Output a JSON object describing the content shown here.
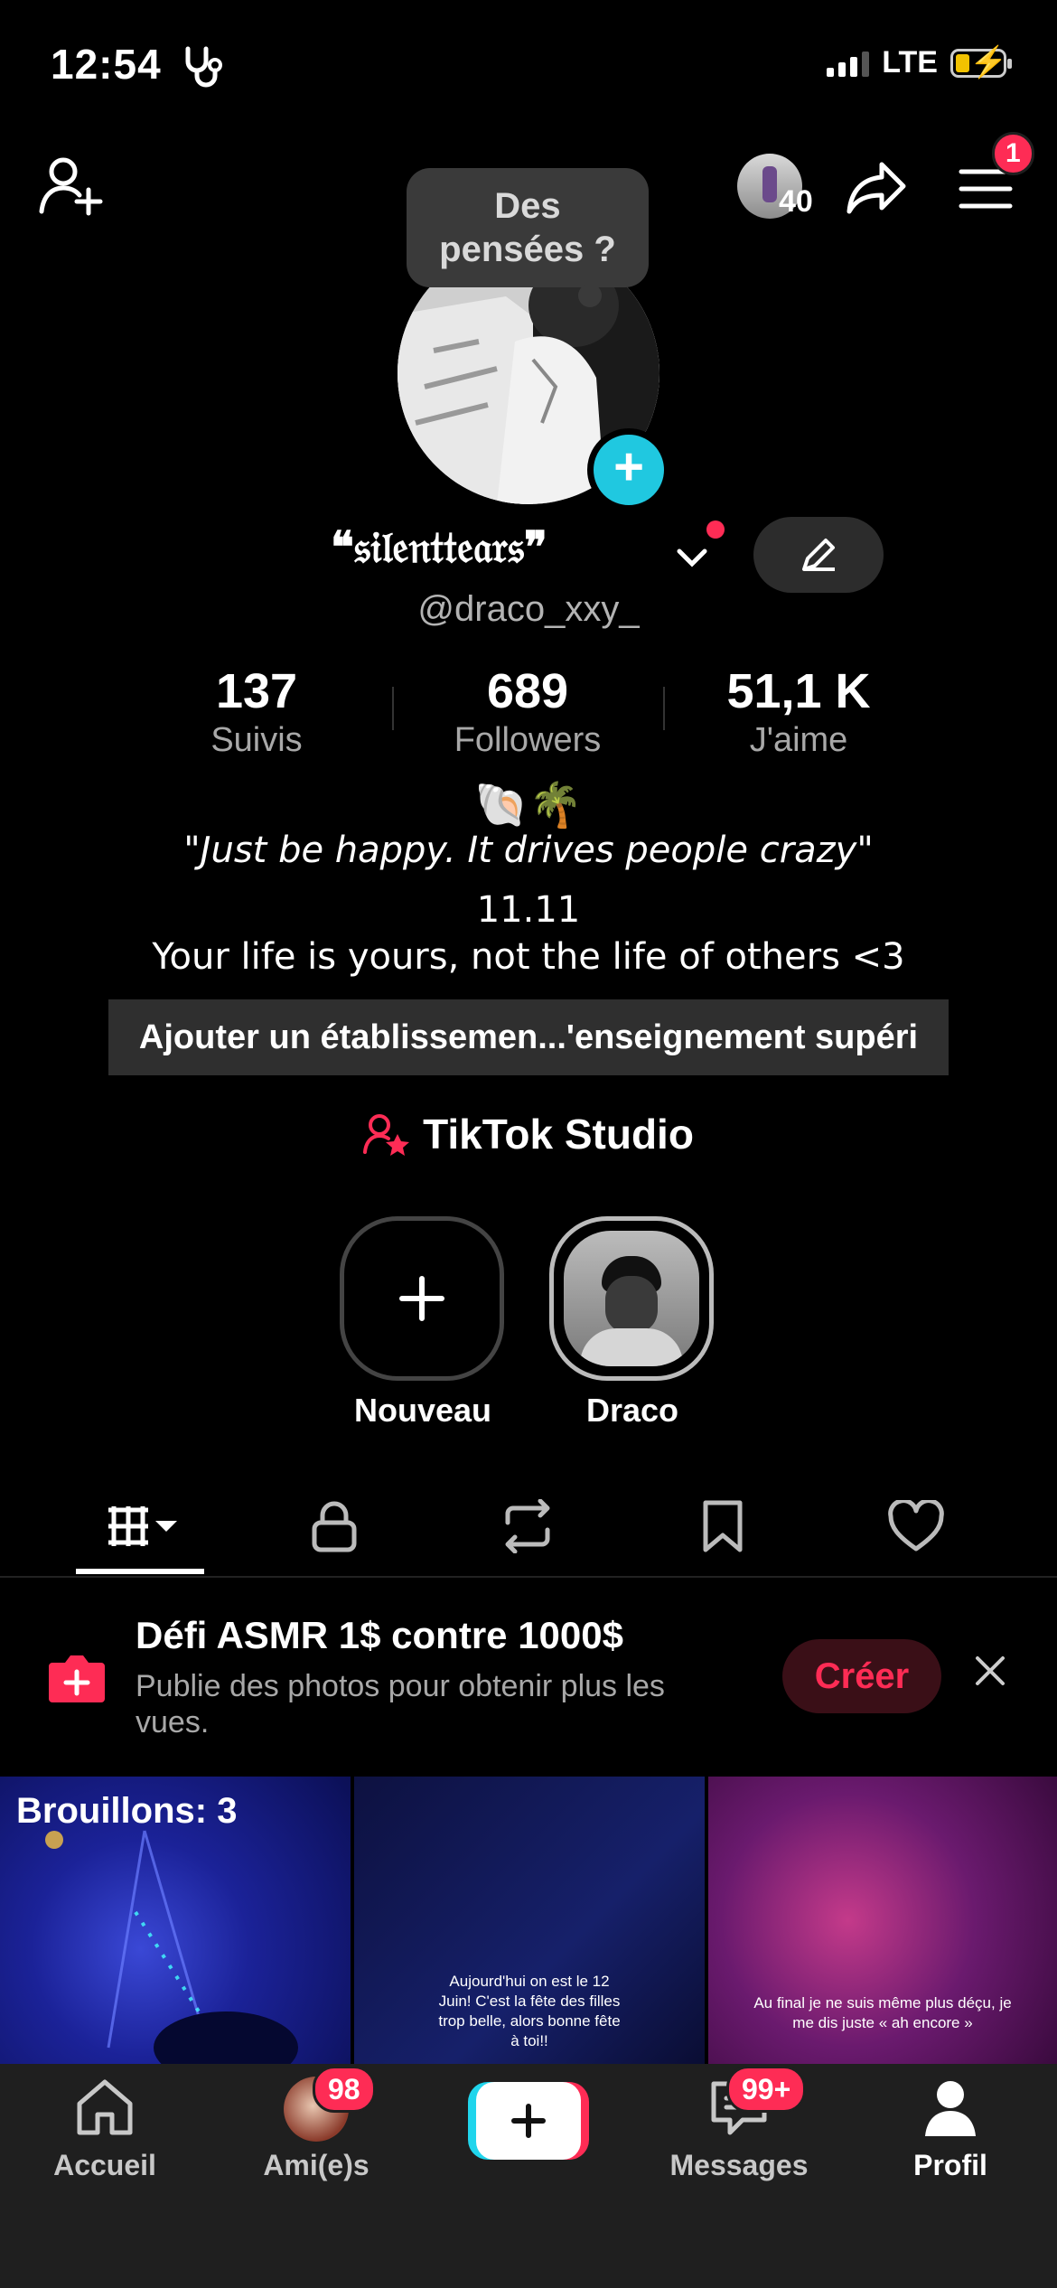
{
  "status_bar": {
    "time": "12:54",
    "network": "LTE"
  },
  "header": {
    "friends_count": "40",
    "menu_badge": "1"
  },
  "thought_bubble": {
    "line1": "Des",
    "line2": "pensées ?"
  },
  "profile": {
    "display_name": "❝𝔰𝔦𝔩𝔢𝔫𝔱𝔱𝔢𝔞𝔯𝔰❞",
    "handle": "@draco_xxy_",
    "stats": [
      {
        "value": "137",
        "label": "Suivis"
      },
      {
        "value": "689",
        "label": "Followers"
      },
      {
        "value": "51,1 K",
        "label": "J'aime"
      }
    ],
    "bio_emoji": "🐚🌴",
    "bio_quote": "\"Just be happy. It drives people crazy\"",
    "bio_line2": "11.11",
    "bio_line3": "Your life is yours, not the life of others <3",
    "school_prompt": "Ajouter un établissemen...'enseignement supéri",
    "studio_label": "TikTok Studio"
  },
  "stories": [
    {
      "label": "Nouveau"
    },
    {
      "label": "Draco"
    }
  ],
  "promo": {
    "title": "Défi ASMR 1$ contre 1000$",
    "subtitle": "Publie des photos pour obtenir plus les vues.",
    "cta": "Créer"
  },
  "grid": {
    "drafts_label": "Brouillons: 3",
    "video2_text": "Aujourd'hui on est le 12 Juin! C'est la fête des filles trop belle, alors bonne fête à toi!!",
    "video3_text": "Au final je ne suis même plus déçu, je me dis juste « ah encore »"
  },
  "nav": {
    "items": [
      {
        "label": "Accueil"
      },
      {
        "label": "Ami(e)s",
        "badge": "98"
      },
      {
        "label": ""
      },
      {
        "label": "Messages",
        "badge": "99+"
      },
      {
        "label": "Profil"
      }
    ]
  },
  "colors": {
    "accent": "#fe2c55",
    "cyan": "#20c8e0",
    "background": "#000000"
  }
}
